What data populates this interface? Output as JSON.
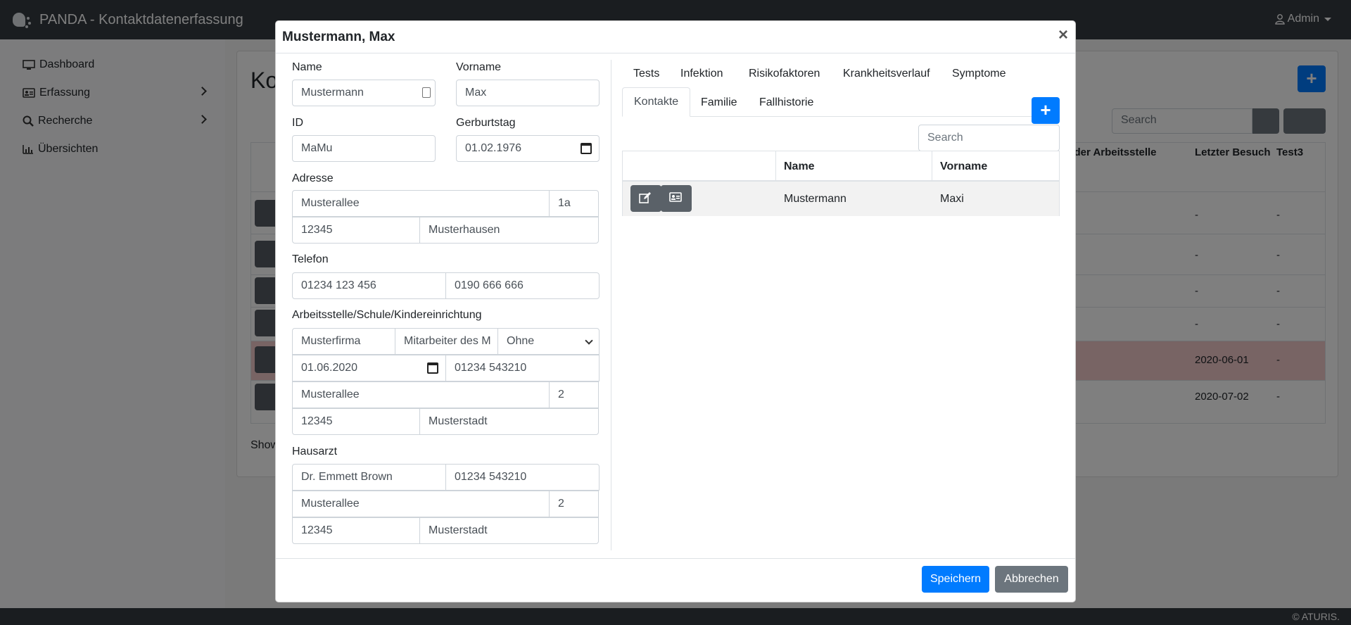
{
  "app": {
    "title": "PANDA - Kontaktdatenerfassung",
    "user": "Admin",
    "footer": "© ATURIS."
  },
  "sidebar": {
    "items": [
      {
        "label": "Dashboard",
        "icon": "monitor-icon"
      },
      {
        "label": "Erfassung",
        "icon": "id-card-icon"
      },
      {
        "label": "Recherche",
        "icon": "search-icon"
      },
      {
        "label": "Übersichten",
        "icon": "chart-icon"
      }
    ]
  },
  "background": {
    "page_title": "Ko",
    "search_placeholder": "Search",
    "columns": [
      "e der Arbeitsstelle",
      "Letzter Besuch",
      "Test3"
    ],
    "rows": [
      {
        "letzter_besuch": "-",
        "test3": "-"
      },
      {
        "letzter_besuch": "-",
        "test3": "-"
      },
      {
        "letzter_besuch": "-",
        "test3": "-"
      },
      {
        "letzter_besuch": "-",
        "test3": "-"
      },
      {
        "letzter_besuch": "2020-06-01",
        "test3": "-"
      },
      {
        "letzter_besuch": "2020-07-02",
        "test3": "-"
      }
    ],
    "show_text": "Show"
  },
  "modal": {
    "title": "Mustermann, Max",
    "close": "×",
    "labels": {
      "name": "Name",
      "vorname": "Vorname",
      "id": "ID",
      "geburtstag": "Gerburtstag",
      "adresse": "Adresse",
      "telefon": "Telefon",
      "arbeitsstelle": "Arbeitsstelle/Schule/Kindereinrichtung",
      "hausarzt": "Hausarzt"
    },
    "values": {
      "name": "Mustermann",
      "vorname": "Max",
      "id": "MaMu",
      "geburtstag": "01.02.1976",
      "strasse": "Musterallee",
      "hausnr": "1a",
      "plz": "12345",
      "ort": "Musterhausen",
      "telefon1": "01234 123 456",
      "telefon2": "0190 666 666",
      "firma": "Musterfirma",
      "position": "Mitarbeiter des M",
      "art": "Ohne",
      "arbeit_datum": "01.06.2020",
      "arbeit_tel": "01234 543210",
      "arbeit_strasse": "Musterallee",
      "arbeit_nr": "2",
      "arbeit_plz": "12345",
      "arbeit_ort": "Musterstadt",
      "arzt_name": "Dr. Emmett Brown",
      "arzt_tel": "01234 543210",
      "arzt_strasse": "Musterallee",
      "arzt_nr": "2",
      "arzt_plz": "12345",
      "arzt_ort": "Musterstadt"
    },
    "tabs": [
      "Tests",
      "Infektion",
      "Risikofaktoren",
      "Krankheitsverlauf",
      "Symptome",
      "Kontakte",
      "Familie",
      "Fallhistorie"
    ],
    "active_tab": "Kontakte",
    "contacts": {
      "search_placeholder": "Search",
      "headers": [
        "Name",
        "Vorname"
      ],
      "rows": [
        {
          "name": "Mustermann",
          "vorname": "Maxi"
        }
      ]
    },
    "buttons": {
      "save": "Speichern",
      "cancel": "Abbrechen"
    }
  }
}
